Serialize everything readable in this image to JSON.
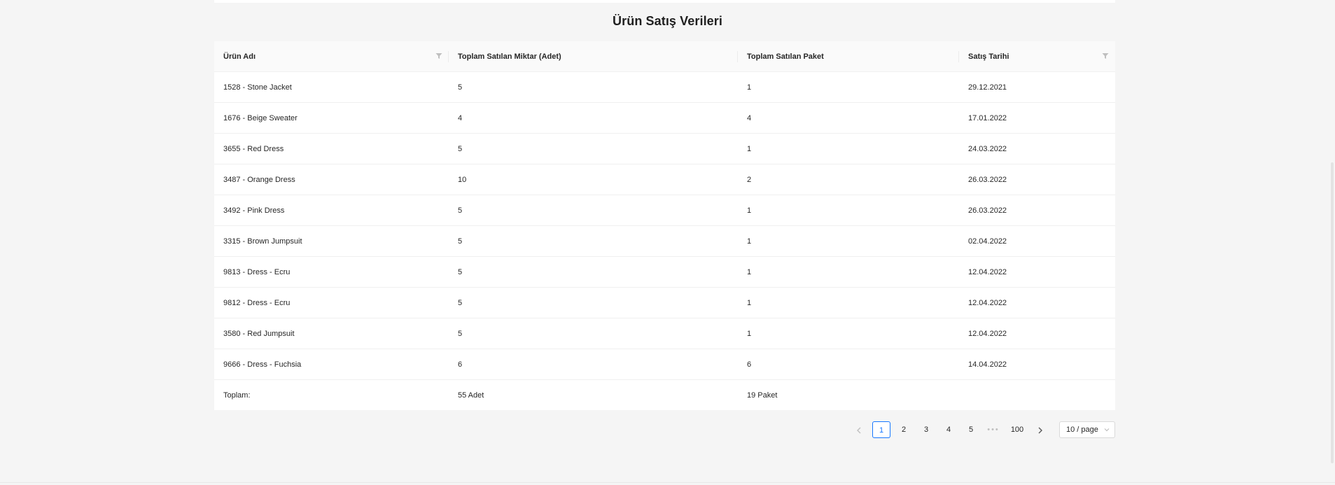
{
  "title": "Ürün Satış Verileri",
  "table": {
    "columns": [
      {
        "label": "Ürün Adı",
        "filter": true
      },
      {
        "label": "Toplam Satılan Miktar (Adet)",
        "filter": false
      },
      {
        "label": "Toplam Satılan Paket",
        "filter": false
      },
      {
        "label": "Satış Tarihi",
        "filter": true
      }
    ],
    "rows": [
      {
        "product": "1528 - Stone Jacket",
        "quantity": "5",
        "packages": "1",
        "date": "29.12.2021"
      },
      {
        "product": "1676 - Beige Sweater",
        "quantity": "4",
        "packages": "4",
        "date": "17.01.2022"
      },
      {
        "product": "3655 - Red Dress",
        "quantity": "5",
        "packages": "1",
        "date": "24.03.2022"
      },
      {
        "product": "3487 - Orange Dress",
        "quantity": "10",
        "packages": "2",
        "date": "26.03.2022"
      },
      {
        "product": "3492 - Pink Dress",
        "quantity": "5",
        "packages": "1",
        "date": "26.03.2022"
      },
      {
        "product": "3315 - Brown Jumpsuit",
        "quantity": "5",
        "packages": "1",
        "date": "02.04.2022"
      },
      {
        "product": "9813 - Dress - Ecru",
        "quantity": "5",
        "packages": "1",
        "date": "12.04.2022"
      },
      {
        "product": "9812 - Dress - Ecru",
        "quantity": "5",
        "packages": "1",
        "date": "12.04.2022"
      },
      {
        "product": "3580 - Red Jumpsuit",
        "quantity": "5",
        "packages": "1",
        "date": "12.04.2022"
      },
      {
        "product": "9666 - Dress - Fuchsia",
        "quantity": "6",
        "packages": "6",
        "date": "14.04.2022"
      }
    ],
    "summary": {
      "label": "Toplam:",
      "quantity": "55 Adet",
      "packages": "19 Paket",
      "date": ""
    }
  },
  "pagination": {
    "prev_icon": "chevron-left-icon",
    "next_icon": "chevron-right-icon",
    "pages": [
      "1",
      "2",
      "3",
      "4",
      "5"
    ],
    "ellipsis": "•••",
    "last_page": "100",
    "current_page": "1",
    "page_size_label": "10 / page"
  },
  "colors": {
    "accent": "#1677ff",
    "background": "#f5f5f5",
    "table_header": "#fafafa"
  }
}
